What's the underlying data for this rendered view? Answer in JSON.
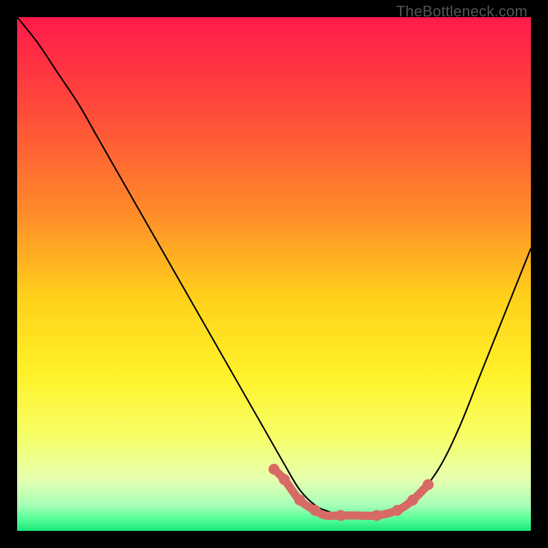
{
  "watermark": "TheBottleneck.com",
  "colors": {
    "frame": "#000000",
    "curve_stroke": "#000000",
    "accent_stroke": "#d86a66",
    "accent_dot": "#d86a66"
  },
  "chart_data": {
    "type": "line",
    "title": "",
    "xlabel": "",
    "ylabel": "",
    "xlim": [
      0,
      100
    ],
    "ylim": [
      0,
      100
    ],
    "gradient_stops": [
      {
        "offset": 0.0,
        "color": "#ff1a4b"
      },
      {
        "offset": 0.18,
        "color": "#ff4a3a"
      },
      {
        "offset": 0.38,
        "color": "#ff8b2a"
      },
      {
        "offset": 0.55,
        "color": "#ffd21a"
      },
      {
        "offset": 0.7,
        "color": "#fff22a"
      },
      {
        "offset": 0.82,
        "color": "#f6ff6a"
      },
      {
        "offset": 0.9,
        "color": "#e6ffb0"
      },
      {
        "offset": 0.95,
        "color": "#a8ffb8"
      },
      {
        "offset": 0.975,
        "color": "#5cff9a"
      },
      {
        "offset": 1.0,
        "color": "#18e87a"
      }
    ],
    "series": [
      {
        "name": "bottleneck-curve",
        "x": [
          0,
          4,
          8,
          12,
          16,
          20,
          24,
          28,
          32,
          36,
          40,
          44,
          48,
          52,
          55,
          58,
          60,
          63,
          66,
          70,
          74,
          78,
          82,
          86,
          90,
          94,
          98,
          100
        ],
        "y": [
          100,
          95,
          89,
          83,
          76,
          69,
          62,
          55,
          48,
          41,
          34,
          27,
          20,
          13,
          8,
          5,
          4,
          3,
          3,
          3,
          4,
          7,
          12,
          20,
          30,
          40,
          50,
          55
        ]
      }
    ],
    "accent_segment": {
      "x": [
        50,
        52,
        55,
        58,
        60,
        63,
        66,
        70,
        74,
        77,
        80
      ],
      "y": [
        12,
        10,
        6,
        4,
        3,
        3,
        3,
        3,
        4,
        6,
        9
      ]
    },
    "accent_dots": [
      {
        "x": 50,
        "y": 12
      },
      {
        "x": 52,
        "y": 10
      },
      {
        "x": 55,
        "y": 6
      },
      {
        "x": 58,
        "y": 4
      },
      {
        "x": 63,
        "y": 3
      },
      {
        "x": 70,
        "y": 3
      },
      {
        "x": 74,
        "y": 4
      },
      {
        "x": 77,
        "y": 6
      },
      {
        "x": 80,
        "y": 9
      }
    ]
  }
}
